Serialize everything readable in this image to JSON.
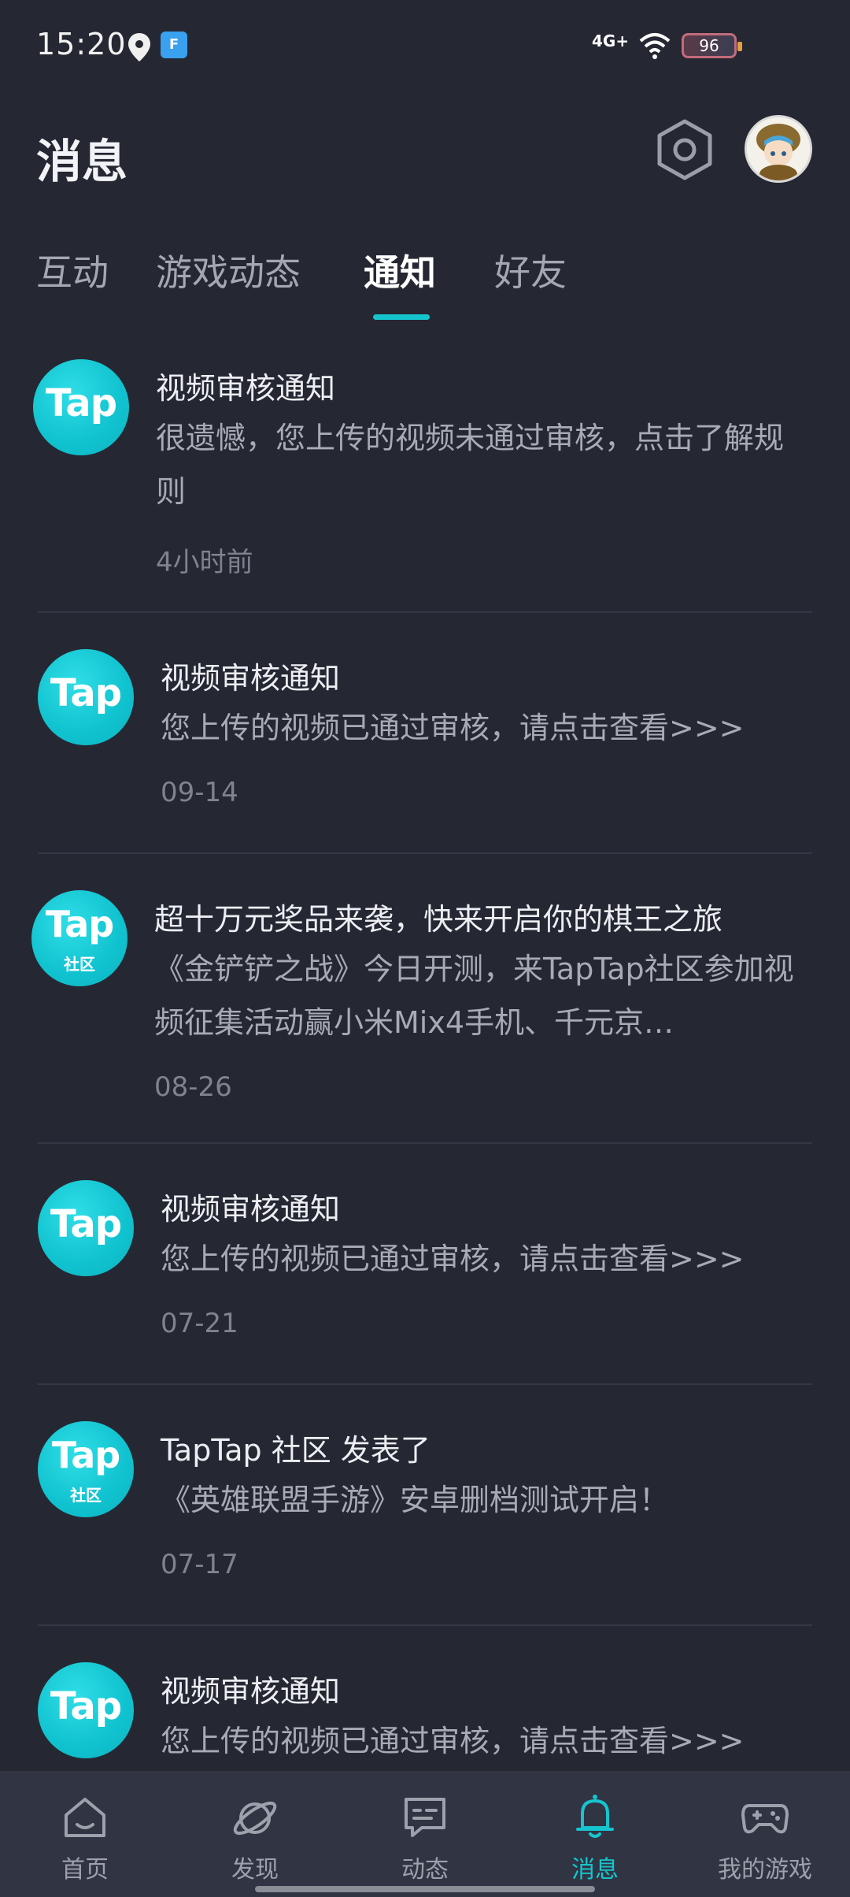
{
  "status_bar": {
    "time": "15:20",
    "network": "4G+",
    "battery": "96"
  },
  "header": {
    "title": "消息"
  },
  "tabs": [
    {
      "label": "互动",
      "active": false
    },
    {
      "label": "游戏动态",
      "active": false
    },
    {
      "label": "通知",
      "active": true
    },
    {
      "label": "好友",
      "active": false
    }
  ],
  "notifications": [
    {
      "logo_text": "Tap",
      "logo_sub": "",
      "title": "视频审核通知",
      "body": "很遗憾，您上传的视频未通过审核，点击了解规则",
      "time": "4小时前"
    },
    {
      "logo_text": "Tap",
      "logo_sub": "",
      "title": "视频审核通知",
      "body": "您上传的视频已通过审核，请点击查看>>>",
      "time": "09-14"
    },
    {
      "logo_text": "Tap",
      "logo_sub": "社区",
      "title": "超十万元奖品来袭，快来开启你的棋王之旅",
      "body": "《金铲铲之战》今日开测，来TapTap社区参加视频征集活动赢小米Mix4手机、千元京…",
      "time": "08-26"
    },
    {
      "logo_text": "Tap",
      "logo_sub": "",
      "title": "视频审核通知",
      "body": "您上传的视频已通过审核，请点击查看>>>",
      "time": "07-21"
    },
    {
      "logo_text": "Tap",
      "logo_sub": "社区",
      "title": "TapTap 社区 发表了",
      "body": "《英雄联盟手游》安卓删档测试开启！",
      "time": "07-17"
    },
    {
      "logo_text": "Tap",
      "logo_sub": "",
      "title": "视频审核通知",
      "body": "您上传的视频已通过审核，请点击查看>>>",
      "time": ""
    }
  ],
  "bottom_nav": [
    {
      "label": "首页",
      "icon": "home-icon",
      "active": false
    },
    {
      "label": "发现",
      "icon": "discover-planet-icon",
      "active": false
    },
    {
      "label": "动态",
      "icon": "chat-bubble-icon",
      "active": false
    },
    {
      "label": "消息",
      "icon": "bell-icon",
      "active": true
    },
    {
      "label": "我的游戏",
      "icon": "gamepad-icon",
      "active": false
    }
  ],
  "colors": {
    "background": "#252833",
    "accent": "#15c5ce",
    "nav_background": "#313443"
  }
}
